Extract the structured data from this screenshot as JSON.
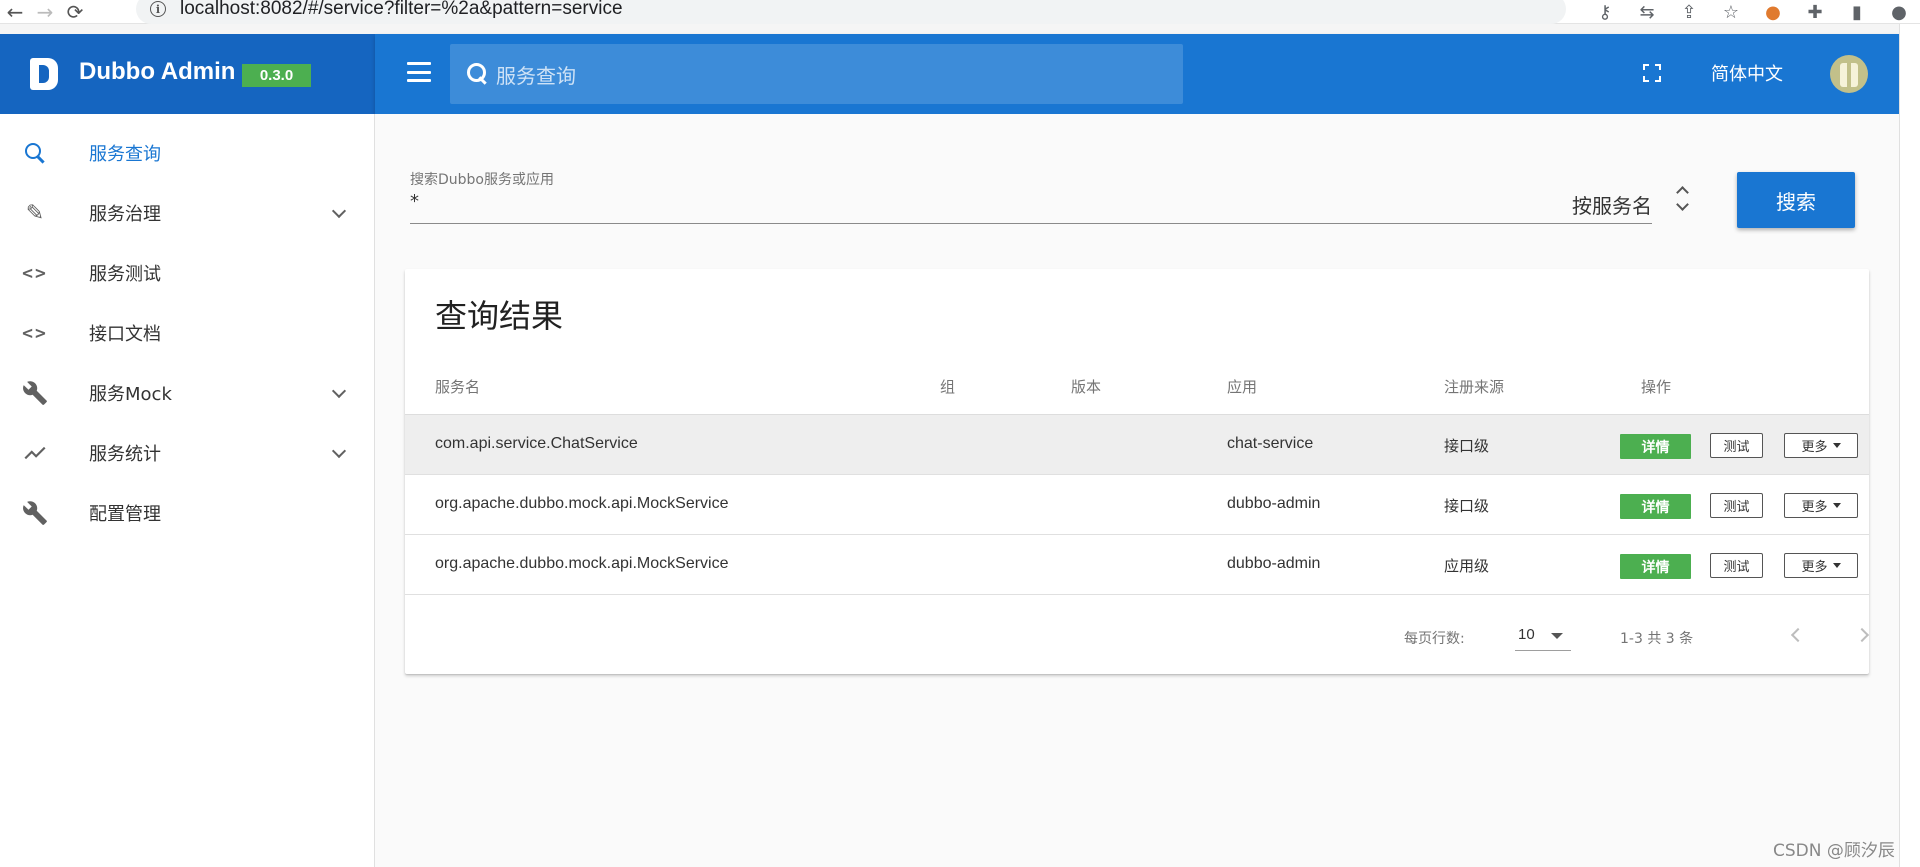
{
  "browser": {
    "url": "localhost:8082/#/service?filter=%2a&pattern=service",
    "back": "←",
    "forward": "→",
    "reload": "⟳",
    "info": "i",
    "icons": [
      "key-icon",
      "translate-icon",
      "share-icon",
      "star-icon",
      "extension-fox-icon",
      "puzzle-icon",
      "sidepanel-icon",
      "profile-icon"
    ]
  },
  "app": {
    "title": "Dubbo Admin",
    "version": "0.3.0",
    "brand_color": "#1565c0",
    "toolbar_color": "#1976d2"
  },
  "toolbar": {
    "search_placeholder": "服务查询",
    "language": "简体中文"
  },
  "sidebar": {
    "items": [
      {
        "label": "服务查询",
        "icon": "search-icon",
        "active": true
      },
      {
        "label": "服务治理",
        "icon": "pencil-icon",
        "expandable": true
      },
      {
        "label": "服务测试",
        "icon": "code-icon"
      },
      {
        "label": "接口文档",
        "icon": "code-icon"
      },
      {
        "label": "服务Mock",
        "icon": "wrench-icon",
        "expandable": true
      },
      {
        "label": "服务统计",
        "icon": "trending-icon",
        "expandable": true
      },
      {
        "label": "配置管理",
        "icon": "wrench-icon"
      }
    ]
  },
  "search": {
    "label": "搜索Dubbo服务或应用",
    "value": "*",
    "pattern": "按服务名",
    "button": "搜索"
  },
  "results": {
    "title": "查询结果",
    "columns": [
      "服务名",
      "组",
      "版本",
      "应用",
      "注册来源",
      "操作"
    ],
    "rows": [
      {
        "service": "com.api.service.ChatService",
        "group": "",
        "version": "",
        "app": "chat-service",
        "source": "接口级"
      },
      {
        "service": "org.apache.dubbo.mock.api.MockService",
        "group": "",
        "version": "",
        "app": "dubbo-admin",
        "source": "接口级"
      },
      {
        "service": "org.apache.dubbo.mock.api.MockService",
        "group": "",
        "version": "",
        "app": "dubbo-admin",
        "source": "应用级"
      }
    ],
    "actions": {
      "detail": "详情",
      "test": "测试",
      "more": "更多"
    },
    "detail_color": "#4caf50"
  },
  "pagination": {
    "rows_per_page_label": "每页行数:",
    "rows_per_page": "10",
    "range": "1-3 共 3 条"
  },
  "watermark": "CSDN @顾汐辰"
}
